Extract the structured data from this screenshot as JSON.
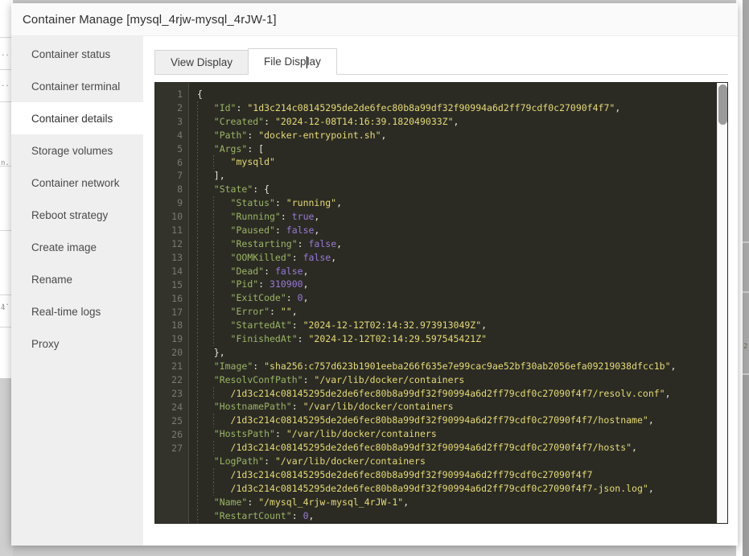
{
  "window": {
    "title": "Container Manage [mysql_4rjw-mysql_4rJW-1]"
  },
  "sidebar": {
    "items": [
      {
        "label": "Container status",
        "active": false
      },
      {
        "label": "Container terminal",
        "active": false
      },
      {
        "label": "Container details",
        "active": true
      },
      {
        "label": "Storage volumes",
        "active": false
      },
      {
        "label": "Container network",
        "active": false
      },
      {
        "label": "Reboot strategy",
        "active": false
      },
      {
        "label": "Create image",
        "active": false
      },
      {
        "label": "Rename",
        "active": false
      },
      {
        "label": "Real-time logs",
        "active": false
      },
      {
        "label": "Proxy",
        "active": false
      }
    ]
  },
  "tabs": [
    {
      "label": "View Display",
      "active": false
    },
    {
      "label": "File Display",
      "active": true,
      "caret_after": "File Disp"
    }
  ],
  "colors": {
    "editor_background": "#2b2b24",
    "gutter_background": "#33332b",
    "key": "#9ab563",
    "string": "#e6da73",
    "literal": "#9a79d8",
    "punctuation": "#e8e8d8",
    "sidebar_background": "#efefef",
    "active_item_background": "#ffffff"
  },
  "scrollbar": {
    "orientation": "vertical",
    "thumb_position": "top"
  },
  "code": {
    "language": "json",
    "first_visible_line": 1,
    "last_visible_line": 27,
    "lines": [
      {
        "n": 1,
        "tokens": [
          {
            "t": "p",
            "v": "{"
          }
        ]
      },
      {
        "n": 2,
        "indent": 1,
        "tokens": [
          {
            "t": "k",
            "v": "\"Id\""
          },
          {
            "t": "p",
            "v": ": "
          },
          {
            "t": "s",
            "v": "\"1d3c214c08145295de2de6fec80b8a99df32f90994a6d2ff79cdf0c27090f4f7\""
          },
          {
            "t": "p",
            "v": ","
          }
        ]
      },
      {
        "n": 3,
        "indent": 1,
        "tokens": [
          {
            "t": "k",
            "v": "\"Created\""
          },
          {
            "t": "p",
            "v": ": "
          },
          {
            "t": "s",
            "v": "\"2024-12-08T14:16:39.182049033Z\""
          },
          {
            "t": "p",
            "v": ","
          }
        ]
      },
      {
        "n": 4,
        "indent": 1,
        "tokens": [
          {
            "t": "k",
            "v": "\"Path\""
          },
          {
            "t": "p",
            "v": ": "
          },
          {
            "t": "s",
            "v": "\"docker-entrypoint.sh\""
          },
          {
            "t": "p",
            "v": ","
          }
        ]
      },
      {
        "n": 5,
        "indent": 1,
        "tokens": [
          {
            "t": "k",
            "v": "\"Args\""
          },
          {
            "t": "p",
            "v": ": ["
          }
        ]
      },
      {
        "n": 6,
        "indent": 2,
        "tokens": [
          {
            "t": "s",
            "v": "\"mysqld\""
          }
        ]
      },
      {
        "n": 7,
        "indent": 1,
        "tokens": [
          {
            "t": "p",
            "v": "],"
          }
        ]
      },
      {
        "n": 8,
        "indent": 1,
        "tokens": [
          {
            "t": "k",
            "v": "\"State\""
          },
          {
            "t": "p",
            "v": ": {"
          }
        ]
      },
      {
        "n": 9,
        "indent": 2,
        "tokens": [
          {
            "t": "k",
            "v": "\"Status\""
          },
          {
            "t": "p",
            "v": ": "
          },
          {
            "t": "s",
            "v": "\"running\""
          },
          {
            "t": "p",
            "v": ","
          }
        ]
      },
      {
        "n": 10,
        "indent": 2,
        "tokens": [
          {
            "t": "k",
            "v": "\"Running\""
          },
          {
            "t": "p",
            "v": ": "
          },
          {
            "t": "b",
            "v": "true"
          },
          {
            "t": "p",
            "v": ","
          }
        ]
      },
      {
        "n": 11,
        "indent": 2,
        "tokens": [
          {
            "t": "k",
            "v": "\"Paused\""
          },
          {
            "t": "p",
            "v": ": "
          },
          {
            "t": "b",
            "v": "false"
          },
          {
            "t": "p",
            "v": ","
          }
        ]
      },
      {
        "n": 12,
        "indent": 2,
        "tokens": [
          {
            "t": "k",
            "v": "\"Restarting\""
          },
          {
            "t": "p",
            "v": ": "
          },
          {
            "t": "b",
            "v": "false"
          },
          {
            "t": "p",
            "v": ","
          }
        ]
      },
      {
        "n": 13,
        "indent": 2,
        "tokens": [
          {
            "t": "k",
            "v": "\"OOMKilled\""
          },
          {
            "t": "p",
            "v": ": "
          },
          {
            "t": "b",
            "v": "false"
          },
          {
            "t": "p",
            "v": ","
          }
        ]
      },
      {
        "n": 14,
        "indent": 2,
        "tokens": [
          {
            "t": "k",
            "v": "\"Dead\""
          },
          {
            "t": "p",
            "v": ": "
          },
          {
            "t": "b",
            "v": "false"
          },
          {
            "t": "p",
            "v": ","
          }
        ]
      },
      {
        "n": 15,
        "indent": 2,
        "tokens": [
          {
            "t": "k",
            "v": "\"Pid\""
          },
          {
            "t": "p",
            "v": ": "
          },
          {
            "t": "n",
            "v": "310900"
          },
          {
            "t": "p",
            "v": ","
          }
        ]
      },
      {
        "n": 16,
        "indent": 2,
        "tokens": [
          {
            "t": "k",
            "v": "\"ExitCode\""
          },
          {
            "t": "p",
            "v": ": "
          },
          {
            "t": "n",
            "v": "0"
          },
          {
            "t": "p",
            "v": ","
          }
        ]
      },
      {
        "n": 17,
        "indent": 2,
        "tokens": [
          {
            "t": "k",
            "v": "\"Error\""
          },
          {
            "t": "p",
            "v": ": "
          },
          {
            "t": "s",
            "v": "\"\""
          },
          {
            "t": "p",
            "v": ","
          }
        ]
      },
      {
        "n": 18,
        "indent": 2,
        "tokens": [
          {
            "t": "k",
            "v": "\"StartedAt\""
          },
          {
            "t": "p",
            "v": ": "
          },
          {
            "t": "s",
            "v": "\"2024-12-12T02:14:32.973913049Z\""
          },
          {
            "t": "p",
            "v": ","
          }
        ]
      },
      {
        "n": 19,
        "indent": 2,
        "tokens": [
          {
            "t": "k",
            "v": "\"FinishedAt\""
          },
          {
            "t": "p",
            "v": ": "
          },
          {
            "t": "s",
            "v": "\"2024-12-12T02:14:29.597545421Z\""
          }
        ]
      },
      {
        "n": 20,
        "indent": 1,
        "tokens": [
          {
            "t": "p",
            "v": "},"
          }
        ]
      },
      {
        "n": 21,
        "indent": 1,
        "tokens": [
          {
            "t": "k",
            "v": "\"Image\""
          },
          {
            "t": "p",
            "v": ": "
          },
          {
            "t": "s",
            "v": "\"sha256:c757d623b1901eeba266f635e7e99cac9ae52bf30ab2056efa09219038dfcc1b\""
          },
          {
            "t": "p",
            "v": ","
          }
        ]
      },
      {
        "n": 22,
        "indent": 1,
        "tokens": [
          {
            "t": "k",
            "v": "\"ResolvConfPath\""
          },
          {
            "t": "p",
            "v": ": "
          },
          {
            "t": "s",
            "v": "\"/var/lib/docker/containers"
          }
        ]
      },
      {
        "n": null,
        "indent": 2,
        "tokens": [
          {
            "t": "s",
            "v": "/1d3c214c08145295de2de6fec80b8a99df32f90994a6d2ff79cdf0c27090f4f7/resolv.conf\""
          },
          {
            "t": "p",
            "v": ","
          }
        ]
      },
      {
        "n": 23,
        "indent": 1,
        "tokens": [
          {
            "t": "k",
            "v": "\"HostnamePath\""
          },
          {
            "t": "p",
            "v": ": "
          },
          {
            "t": "s",
            "v": "\"/var/lib/docker/containers"
          }
        ]
      },
      {
        "n": null,
        "indent": 2,
        "tokens": [
          {
            "t": "s",
            "v": "/1d3c214c08145295de2de6fec80b8a99df32f90994a6d2ff79cdf0c27090f4f7/hostname\""
          },
          {
            "t": "p",
            "v": ","
          }
        ]
      },
      {
        "n": 24,
        "indent": 1,
        "tokens": [
          {
            "t": "k",
            "v": "\"HostsPath\""
          },
          {
            "t": "p",
            "v": ": "
          },
          {
            "t": "s",
            "v": "\"/var/lib/docker/containers"
          }
        ]
      },
      {
        "n": null,
        "indent": 2,
        "tokens": [
          {
            "t": "s",
            "v": "/1d3c214c08145295de2de6fec80b8a99df32f90994a6d2ff79cdf0c27090f4f7/hosts\""
          },
          {
            "t": "p",
            "v": ","
          }
        ]
      },
      {
        "n": 25,
        "indent": 1,
        "tokens": [
          {
            "t": "k",
            "v": "\"LogPath\""
          },
          {
            "t": "p",
            "v": ": "
          },
          {
            "t": "s",
            "v": "\"/var/lib/docker/containers"
          }
        ]
      },
      {
        "n": null,
        "indent": 2,
        "tokens": [
          {
            "t": "s",
            "v": "/1d3c214c08145295de2de6fec80b8a99df32f90994a6d2ff79cdf0c27090f4f7"
          }
        ]
      },
      {
        "n": null,
        "indent": 2,
        "tokens": [
          {
            "t": "s",
            "v": "/1d3c214c08145295de2de6fec80b8a99df32f90994a6d2ff79cdf0c27090f4f7-json.log\""
          },
          {
            "t": "p",
            "v": ","
          }
        ]
      },
      {
        "n": 26,
        "indent": 1,
        "tokens": [
          {
            "t": "k",
            "v": "\"Name\""
          },
          {
            "t": "p",
            "v": ": "
          },
          {
            "t": "s",
            "v": "\"/mysql_4rjw-mysql_4rJW-1\""
          },
          {
            "t": "p",
            "v": ","
          }
        ]
      },
      {
        "n": 27,
        "indent": 1,
        "tokens": [
          {
            "t": "k",
            "v": "\"RestartCount\""
          },
          {
            "t": "p",
            "v": ": "
          },
          {
            "t": "n",
            "v": "0"
          },
          {
            "t": "p",
            "v": ","
          }
        ]
      }
    ]
  },
  "background": {
    "ghost_right_glyph": "2"
  }
}
